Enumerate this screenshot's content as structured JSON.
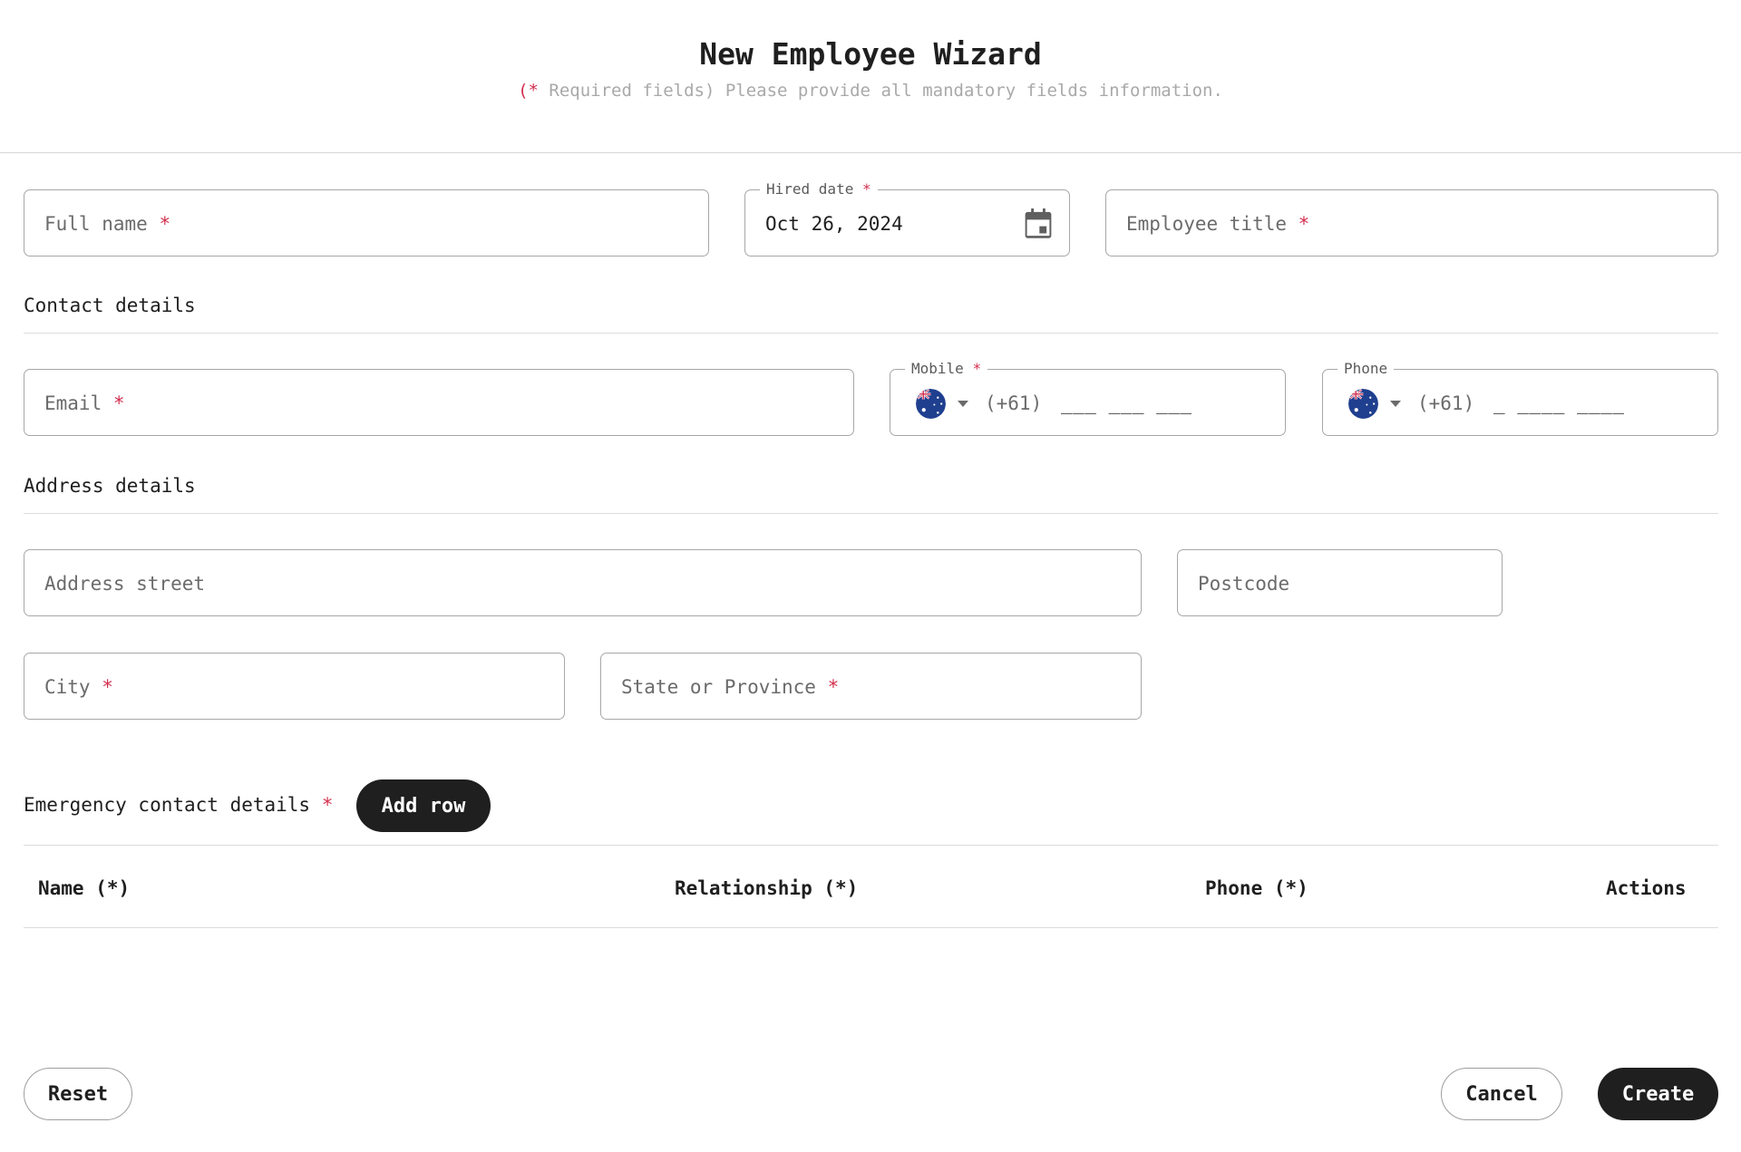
{
  "header": {
    "title": "New Employee Wizard",
    "required_mark": "(*",
    "subtitle_rest": " Required fields) Please provide all mandatory fields information."
  },
  "required_symbol": "*",
  "fields": {
    "full_name": {
      "placeholder": "Full name"
    },
    "hired_date": {
      "label": "Hired date",
      "value": "Oct 26, 2024"
    },
    "employee_title": {
      "placeholder": "Employee title"
    },
    "email": {
      "placeholder": "Email"
    },
    "mobile": {
      "label": "Mobile",
      "dial_code": "(+61)",
      "mask": "___ ___ ___"
    },
    "phone": {
      "label": "Phone",
      "dial_code": "(+61)",
      "mask": "_ ____ ____"
    },
    "address_street": {
      "placeholder": "Address street"
    },
    "postcode": {
      "placeholder": "Postcode"
    },
    "city": {
      "placeholder": "City"
    },
    "state": {
      "placeholder": "State or Province"
    }
  },
  "sections": {
    "contact": "Contact details",
    "address": "Address details",
    "emergency": "Emergency contact details"
  },
  "buttons": {
    "add_row": "Add row",
    "reset": "Reset",
    "cancel": "Cancel",
    "create": "Create"
  },
  "table": {
    "columns": [
      "Name (*)",
      "Relationship (*)",
      "Phone (*)",
      "Actions"
    ]
  },
  "colors": {
    "required": "#d32f4f",
    "primary_button": "#1f1f1f",
    "border": "#a7a7a7"
  },
  "icons": {
    "calendar": "calendar-icon",
    "flag": "australia-flag-icon",
    "dropdown": "caret-down-icon"
  }
}
